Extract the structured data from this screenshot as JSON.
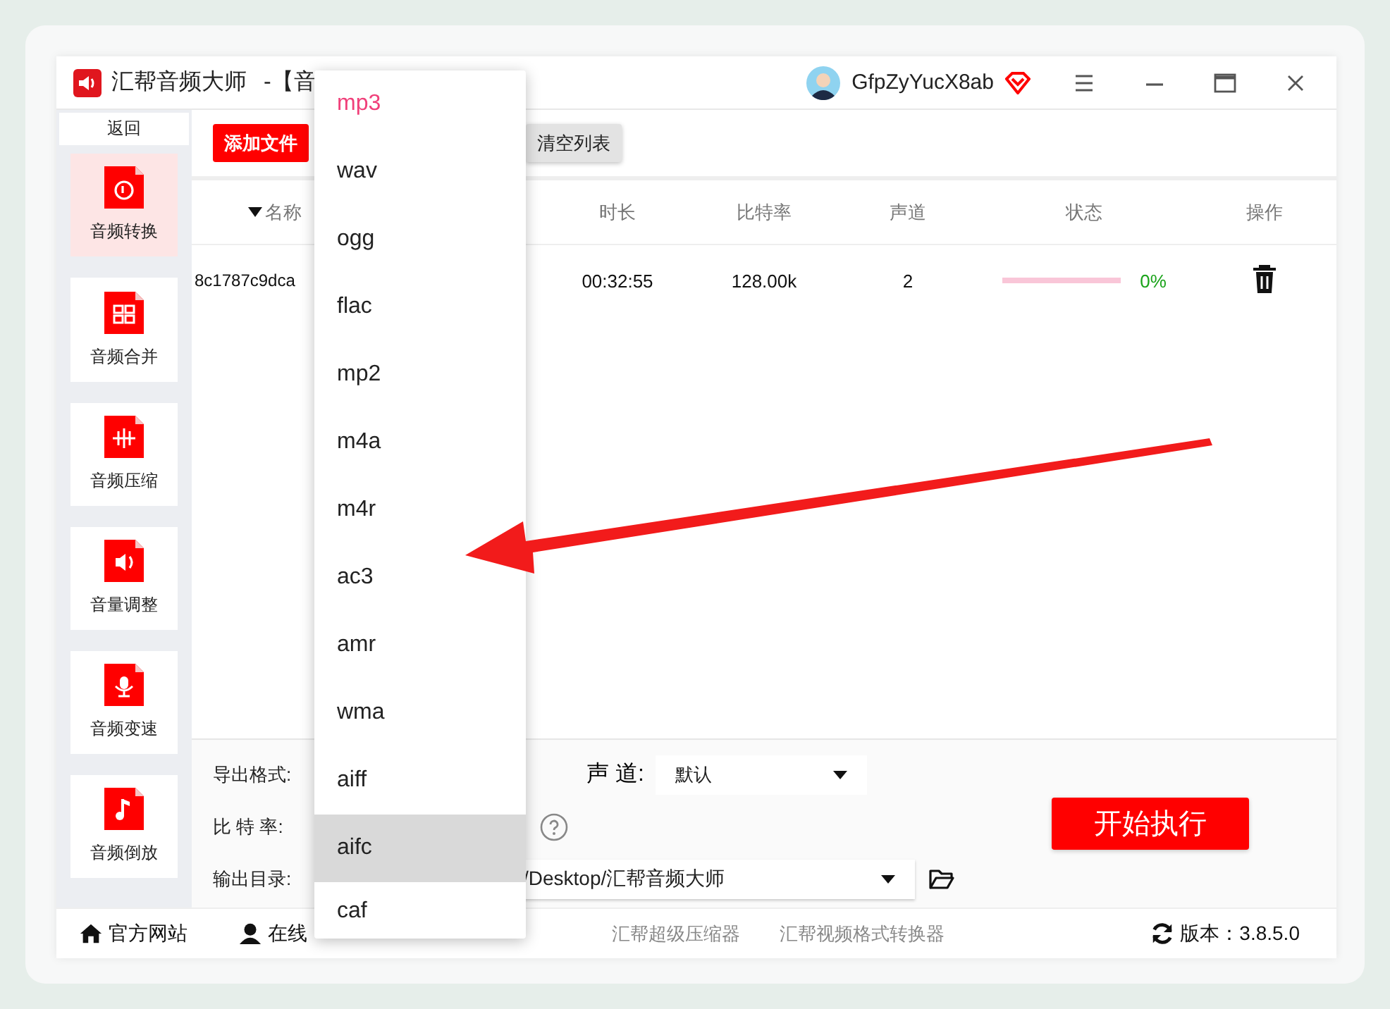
{
  "window": {
    "title": "汇帮音频大师",
    "subtitle": "-【音"
  },
  "user": {
    "name": "GfpZyYucX8ab"
  },
  "sidebar": {
    "back": "返回",
    "items": [
      {
        "label": "音频转换",
        "selected": true
      },
      {
        "label": "音频合并",
        "selected": false
      },
      {
        "label": "音频压缩",
        "selected": false
      },
      {
        "label": "音量调整",
        "selected": false
      },
      {
        "label": "音频变速",
        "selected": false
      },
      {
        "label": "音频倒放",
        "selected": false
      }
    ]
  },
  "toolbar": {
    "buttons": [
      {
        "label": "添加文件",
        "kind": "primary"
      },
      {
        "label": "清空列表",
        "kind": "secondary"
      }
    ]
  },
  "table": {
    "columns": [
      {
        "label": "名称",
        "sorted": true
      },
      {
        "label": "时长",
        "sorted": false
      },
      {
        "label": "比特率",
        "sorted": false
      },
      {
        "label": "声道",
        "sorted": false
      },
      {
        "label": "状态",
        "sorted": false
      },
      {
        "label": "操作",
        "sorted": false
      }
    ],
    "rows": [
      {
        "name": "8c1787c9dca",
        "duration": "00:32:55",
        "bitrate": "128.00k",
        "channels": "2",
        "progress": {
          "level": 0,
          "reading": "0%"
        }
      }
    ]
  },
  "settings": {
    "format_label": "导出格式:",
    "channel_label": "声 道:",
    "channel_value": "默认",
    "bitrate_label": "比 特 率:",
    "output_label": "输出目录:",
    "output_path": "/Desktop/汇帮音频大师",
    "start_button": "开始执行"
  },
  "footer": {
    "links": [
      {
        "label": "官方网站",
        "kind": "home"
      },
      {
        "label": "在线",
        "kind": "support"
      },
      {
        "label": "汇帮超级压缩器",
        "kind": "plain"
      },
      {
        "label": "汇帮视频格式转换器",
        "kind": "plain"
      }
    ],
    "version": "版本：3.8.5.0"
  },
  "format_menu": {
    "items": [
      {
        "label": "mp3",
        "selected": true,
        "highlighted": false
      },
      {
        "label": "wav",
        "selected": false,
        "highlighted": false
      },
      {
        "label": "ogg",
        "selected": false,
        "highlighted": false
      },
      {
        "label": "flac",
        "selected": false,
        "highlighted": false
      },
      {
        "label": "mp2",
        "selected": false,
        "highlighted": false
      },
      {
        "label": "m4a",
        "selected": false,
        "highlighted": false
      },
      {
        "label": "m4r",
        "selected": false,
        "highlighted": false
      },
      {
        "label": "ac3",
        "selected": false,
        "highlighted": false
      },
      {
        "label": "amr",
        "selected": false,
        "highlighted": false
      },
      {
        "label": "wma",
        "selected": false,
        "highlighted": false
      },
      {
        "label": "aiff",
        "selected": false,
        "highlighted": false
      },
      {
        "label": "aifc",
        "selected": false,
        "highlighted": true
      },
      {
        "label": "caf",
        "selected": false,
        "highlighted": false
      }
    ]
  }
}
